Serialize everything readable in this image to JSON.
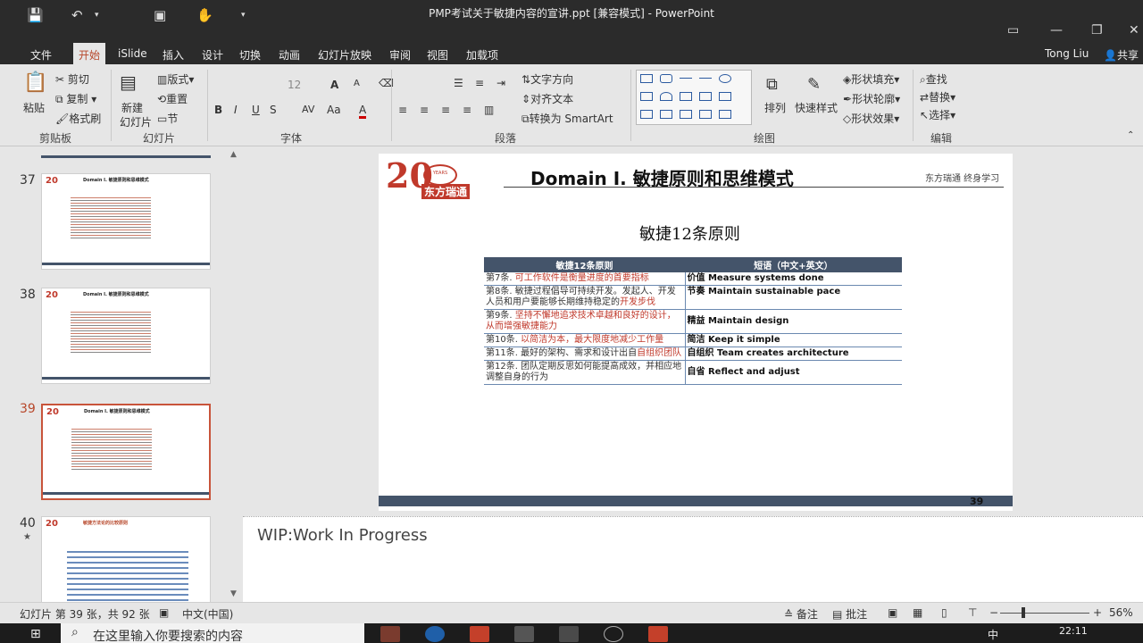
{
  "window": {
    "title": "PMP考试关于敏捷内容的宣讲.ppt [兼容模式] - PowerPoint",
    "user": "Tong Liu",
    "share": "共享"
  },
  "tabs": [
    "文件",
    "开始",
    "iSlide",
    "插入",
    "设计",
    "切换",
    "动画",
    "幻灯片放映",
    "审阅",
    "视图",
    "加载项"
  ],
  "ribbon": {
    "clipboard": {
      "paste": "粘贴",
      "cut": "剪切",
      "copy": "复制",
      "format_painter": "格式刷",
      "label": "剪贴板"
    },
    "slides": {
      "new_slide": "新建",
      "new_slide2": "幻灯片",
      "layout": "版式",
      "reset": "重置",
      "section": "节",
      "label": "幻灯片"
    },
    "font": {
      "size": "12",
      "label": "字体",
      "bold": "B",
      "italic": "I",
      "underline": "U",
      "strike": "S",
      "spacing": "AV",
      "case": "Aa",
      "color": "A",
      "grow": "A",
      "shrink": "A"
    },
    "paragraph": {
      "text_direction": "文字方向",
      "align_text": "对齐文本",
      "smartart": "转换为 SmartArt",
      "label": "段落"
    },
    "drawing": {
      "arrange": "排列",
      "quick_styles": "快速样式",
      "shape_fill": "形状填充",
      "shape_outline": "形状轮廓",
      "shape_effects": "形状效果",
      "label": "绘图"
    },
    "editing": {
      "find": "查找",
      "replace": "替换",
      "select": "选择",
      "label": "编辑"
    }
  },
  "thumbnails": [
    {
      "num": "37",
      "title": "Domain I. 敏捷原则和思维模式"
    },
    {
      "num": "38",
      "title": "Domain I. 敏捷原则和思维模式"
    },
    {
      "num": "39",
      "title": "Domain I. 敏捷原则和思维模式"
    },
    {
      "num": "40",
      "title": "敏捷方法论的比较原则"
    }
  ],
  "slide": {
    "logo_num": "20",
    "logo_years": "YEARS",
    "logo_cn": "东方瑞通",
    "header": "Domain I. 敏捷原则和思维模式",
    "tagline": "东方瑞通  终身学习",
    "subtitle": "敏捷12条原则",
    "table": {
      "headers": [
        "敏捷12条原则",
        "短语（中文+英文）"
      ],
      "rows": [
        {
          "left_prefix": "第7条. ",
          "left_red": "可工作软件是衡量进度的首要指标",
          "left_suffix": "",
          "right": "价值 Measure systems done"
        },
        {
          "left_prefix": "第8条. 敏捷过程倡导可持续开发。发起人、开发人员和用户要能够长期维持稳定的",
          "left_red": "开发步伐",
          "left_suffix": "",
          "right": "节奏 Maintain sustainable pace"
        },
        {
          "left_prefix": "第9条. ",
          "left_red": "坚持不懈地追求技术卓越和良好的设计，从而增强敏捷能力",
          "left_suffix": "",
          "right": "精益 Maintain design"
        },
        {
          "left_prefix": "第10条. ",
          "left_red": "以简洁为本，最大限度地减少工作量",
          "left_suffix": "",
          "right": "简洁 Keep it simple"
        },
        {
          "left_prefix": "第11条. 最好的架构、需求和设计出自",
          "left_red": "自组织团队",
          "left_suffix": "",
          "right": "自组织 Team creates architecture"
        },
        {
          "left_prefix": "第12条. 团队定期反思如何能提高成效，并相应地调整自身的行为",
          "left_red": "",
          "left_suffix": "",
          "right": "自省 Reflect and adjust"
        }
      ]
    },
    "page_number": "39"
  },
  "notes": "WIP:Work In Progress",
  "status": {
    "slide_info": "幻灯片 第 39 张，共 92 张",
    "language": "中文(中国)",
    "notes_btn": "备注",
    "comments_btn": "批注",
    "zoom": "56%"
  },
  "taskbar": {
    "search_placeholder": "在这里输入你要搜索的内容",
    "time": "22:11",
    "ime": "中"
  }
}
